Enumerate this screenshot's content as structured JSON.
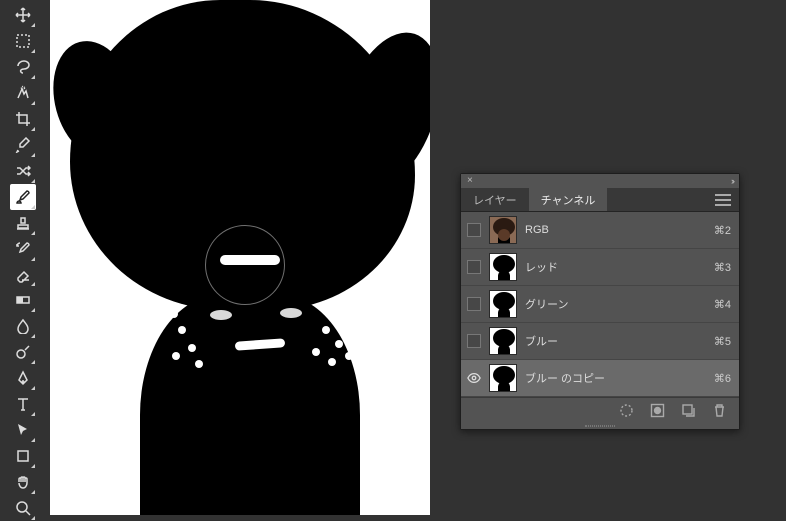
{
  "panel": {
    "tabs": {
      "layers": "レイヤー",
      "channels": "チャンネル"
    },
    "channels": [
      {
        "label": "RGB",
        "shortcut": "⌘2",
        "visible": false,
        "selected": false,
        "thumb": "rgb"
      },
      {
        "label": "レッド",
        "shortcut": "⌘3",
        "visible": false,
        "selected": false,
        "thumb": "bw"
      },
      {
        "label": "グリーン",
        "shortcut": "⌘4",
        "visible": false,
        "selected": false,
        "thumb": "bw"
      },
      {
        "label": "ブルー",
        "shortcut": "⌘5",
        "visible": false,
        "selected": false,
        "thumb": "bw"
      },
      {
        "label": "ブルー のコピー",
        "shortcut": "⌘6",
        "visible": true,
        "selected": true,
        "thumb": "bw"
      }
    ]
  },
  "tools": [
    {
      "name": "move-tool"
    },
    {
      "name": "marquee-tool"
    },
    {
      "name": "lasso-tool"
    },
    {
      "name": "quick-select-tool"
    },
    {
      "name": "crop-tool"
    },
    {
      "name": "eyedropper-tool"
    },
    {
      "name": "shuffle-tool"
    },
    {
      "name": "brush-tool",
      "selected": true
    },
    {
      "name": "stamp-tool"
    },
    {
      "name": "history-brush-tool"
    },
    {
      "name": "eraser-tool"
    },
    {
      "name": "gradient-tool"
    },
    {
      "name": "blur-tool"
    },
    {
      "name": "dodge-tool"
    },
    {
      "name": "pen-tool"
    },
    {
      "name": "type-tool"
    },
    {
      "name": "path-select-tool"
    },
    {
      "name": "shape-tool"
    },
    {
      "name": "hand-tool"
    },
    {
      "name": "zoom-tool"
    }
  ],
  "dots": [
    {
      "l": 128,
      "t": 326
    },
    {
      "l": 138,
      "t": 344
    },
    {
      "l": 122,
      "t": 352
    },
    {
      "l": 145,
      "t": 360
    },
    {
      "l": 272,
      "t": 326
    },
    {
      "l": 285,
      "t": 340
    },
    {
      "l": 262,
      "t": 348
    },
    {
      "l": 278,
      "t": 358
    },
    {
      "l": 295,
      "t": 352
    },
    {
      "l": 120,
      "t": 310
    }
  ]
}
